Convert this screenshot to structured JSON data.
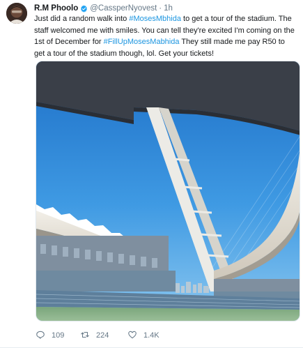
{
  "tweet": {
    "author_name": "R.M Phoolo",
    "handle": "@CassperNyovest",
    "separator": "·",
    "time": "1h",
    "text_parts": [
      "Just did a random walk into ",
      "#MosesMbhida",
      " to get a tour of the stadium. The staff welcomed me with smiles. You can tell they're excited I'm coming on the 1st of December for ",
      "#FillUpMosesMabhida",
      " They still made me pay R50 to get a tour of the stadium though, lol. Get your tickets!"
    ]
  },
  "actions": {
    "reply_count": "109",
    "retweet_count": "224",
    "like_count": "1.4K"
  },
  "colors": {
    "link": "#1b95e0",
    "secondary_text": "#657786",
    "verified": "#1da1f2"
  },
  "icons": {
    "reply": "speech-bubble-icon",
    "retweet": "retweet-arrows-icon",
    "like": "heart-icon",
    "verified": "verified-badge-icon"
  }
}
